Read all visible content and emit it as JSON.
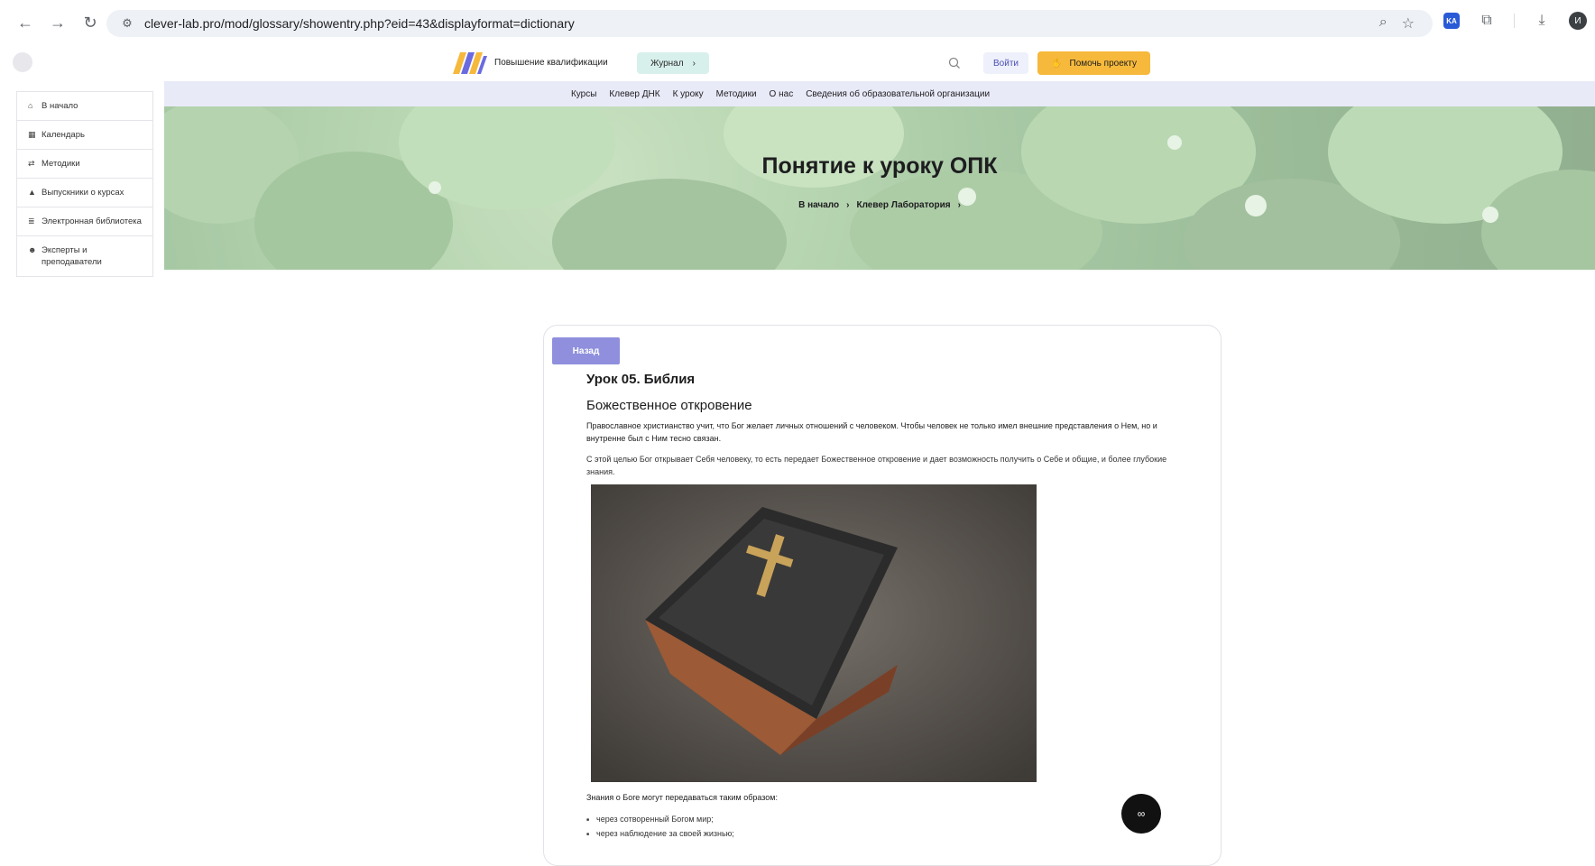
{
  "browser": {
    "url": "clever-lab.pro/mod/glossary/showentry.php?eid=43&displayformat=dictionary",
    "profile_initial": "И",
    "ext_ka": "KA"
  },
  "header": {
    "brand": "Повышение квалификации",
    "journal_label": "Журнал",
    "login_label": "Войти",
    "help_label": "Помочь проекту"
  },
  "subnav": [
    "Курсы",
    "Клевер ДНК",
    "К уроку",
    "Методики",
    "О нас",
    "Сведения об образовательной организации"
  ],
  "sidebar": {
    "items": [
      {
        "icon": "home-icon",
        "label": "В начало"
      },
      {
        "icon": "calendar-icon",
        "label": "Календарь"
      },
      {
        "icon": "methods-icon",
        "label": "Методики"
      },
      {
        "icon": "graduation-icon",
        "label": "Выпускники о курсах"
      },
      {
        "icon": "database-icon",
        "label": "Электронная библиотека"
      },
      {
        "icon": "users-icon",
        "label": "Эксперты и преподаватели"
      }
    ]
  },
  "hero": {
    "title": "Понятие к уроку ОПК",
    "breadcrumb": [
      "В начало",
      "Клевер Лаборатория"
    ]
  },
  "content": {
    "back_label": "Назад",
    "lesson_title": "Урок 05. Библия",
    "section_title": "Божественное откровение",
    "para1": "Православное христианство учит, что Бог желает личных отношений с человеком. Чтобы человек не только имел внешние представления о Нем, но и внутренне был с Ним тесно связан.",
    "para2": "С этой целью Бог открывает Себя человеку, то есть передает Божественное откровение и дает возможность получить о Себе и общие, и более глубокие знания.",
    "knowledge_intro": "Знания о Боге могут передаваться таким образом:",
    "list": [
      "через сотворенный Богом мир;",
      "через наблюдение за своей жизнью;"
    ]
  },
  "colors": {
    "accent": "#8f8fdd",
    "help": "#f6b93b",
    "journal": "#d8f0ec",
    "subnav": "#e9eaf8"
  }
}
